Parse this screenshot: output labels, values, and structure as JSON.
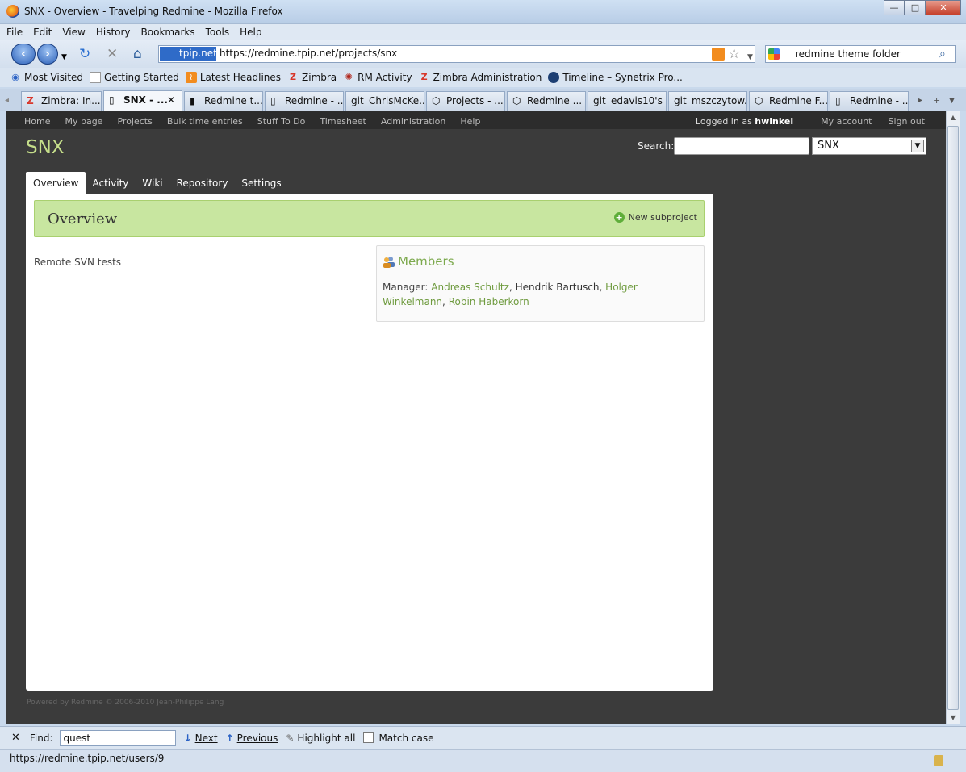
{
  "window": {
    "title": "SNX - Overview - Travelping Redmine - Mozilla Firefox",
    "min": "—",
    "max": "□",
    "close": "✕"
  },
  "menu": [
    "File",
    "Edit",
    "View",
    "History",
    "Bookmarks",
    "Tools",
    "Help"
  ],
  "navbar": {
    "identity": "tpip.net",
    "url": "https://redmine.tpip.net/projects/snx",
    "search_value": "redmine theme folder"
  },
  "bookmarks": [
    "Most Visited",
    "Getting Started",
    "Latest Headlines",
    "Zimbra",
    "RM Activity",
    "Zimbra Administration",
    "Timeline – Synetrix Pro..."
  ],
  "tabs": [
    "Zimbra: In...",
    "SNX - ...",
    "Redmine t...",
    "Redmine - ...",
    "ChrisMcKe...",
    "Projects - ...",
    "Redmine ...",
    "edavis10's ...",
    "mszczytow...",
    "Redmine F...",
    "Redmine - ..."
  ],
  "redmine": {
    "top_menu": [
      "Home",
      "My page",
      "Projects",
      "Bulk time entries",
      "Stuff To Do",
      "Timesheet",
      "Administration",
      "Help"
    ],
    "logged_in_prefix": "Logged in as",
    "logged_in_user": "hwinkel",
    "my_account": "My account",
    "sign_out": "Sign out",
    "project_title": "SNX",
    "search_label": "Search:",
    "project_select": "SNX",
    "project_tabs": [
      "Overview",
      "Activity",
      "Wiki",
      "Repository",
      "Settings"
    ],
    "overview_heading": "Overview",
    "new_subproject": "New subproject",
    "description": "Remote SVN tests",
    "members_heading": "Members",
    "members_role": "Manager:",
    "members": [
      "Andreas Schultz",
      "Hendrik Bartusch",
      "Holger Winkelmann",
      "Robin Haberkorn"
    ],
    "footer": "Powered by Redmine © 2006-2010 Jean-Philippe Lang"
  },
  "findbar": {
    "label": "Find:",
    "value": "quest",
    "next": "Next",
    "previous": "Previous",
    "highlight": "Highlight all",
    "match_case": "Match case"
  },
  "status": {
    "url": "https://redmine.tpip.net/users/9"
  }
}
